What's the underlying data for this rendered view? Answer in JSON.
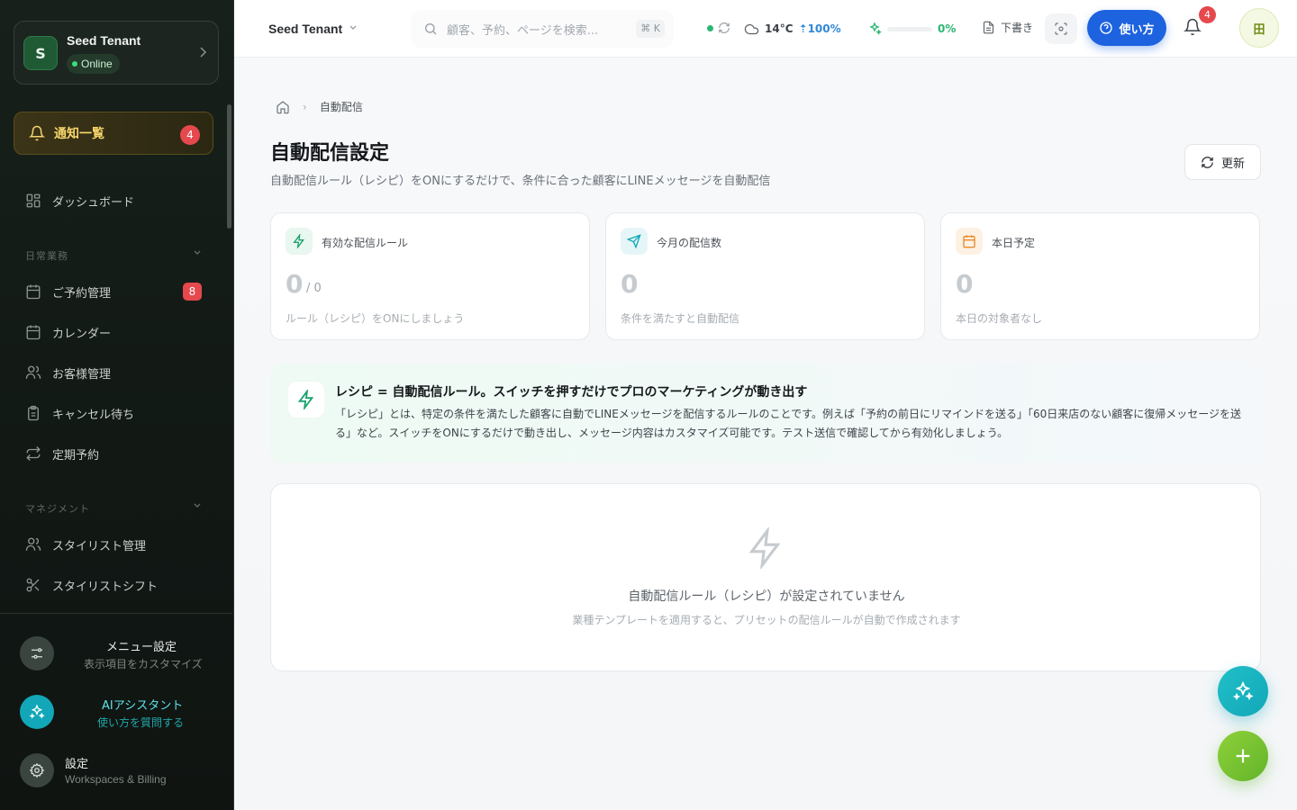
{
  "sidebar": {
    "tenant": {
      "initial": "S",
      "name": "Seed Tenant",
      "status": "Online"
    },
    "notifications": {
      "label": "通知一覧",
      "count": "4"
    },
    "dashboard": "ダッシュボード",
    "sections": [
      {
        "title": "日常業務",
        "items": [
          {
            "label": "ご予約管理",
            "badge": "8",
            "icon": "calendar-grid-icon"
          },
          {
            "label": "カレンダー",
            "icon": "calendar-icon"
          },
          {
            "label": "お客様管理",
            "icon": "users-icon"
          },
          {
            "label": "キャンセル待ち",
            "icon": "clipboard-icon"
          },
          {
            "label": "定期予約",
            "icon": "repeat-icon"
          }
        ]
      },
      {
        "title": "マネジメント",
        "items": [
          {
            "label": "スタイリスト管理",
            "icon": "users-icon"
          },
          {
            "label": "スタイリストシフト",
            "icon": "scissors-icon"
          }
        ]
      }
    ],
    "bottom": [
      {
        "title": "メニュー設定",
        "subtitle": "表示項目をカスタマイズ",
        "icon": "sliders-icon"
      },
      {
        "title": "AIアシスタント",
        "subtitle": "使い方を質問する",
        "icon": "sparkles-icon"
      },
      {
        "title": "設定",
        "subtitle": "Workspaces & Billing",
        "icon": "gear-icon"
      }
    ]
  },
  "topbar": {
    "workspace": "Seed Tenant",
    "search_placeholder": "顧客、予約、ページを検索...",
    "search_shortcut": "⌘ K",
    "weather": {
      "temp": "14°C",
      "humidity": "100%"
    },
    "progress": {
      "value": 0,
      "label": "0%"
    },
    "draft": "下書き",
    "howto": "使い方",
    "bell_count": "4",
    "user_initial": "田"
  },
  "main": {
    "breadcrumb": "自動配信",
    "title": "自動配信設定",
    "subtitle": "自動配信ルール（レシピ）をONにするだけで、条件に合った顧客にLINEメッセージを自動配信",
    "refresh": "更新",
    "stats": [
      {
        "label": "有効な配信ルール",
        "value": "0",
        "of": "/ 0",
        "hint": "ルール（レシピ）をONにしましょう",
        "color": "#1aa36b"
      },
      {
        "label": "今月の配信数",
        "value": "0",
        "hint": "条件を満たすと自動配信",
        "color": "#12a7b8"
      },
      {
        "label": "本日予定",
        "value": "0",
        "hint": "本日の対象者なし",
        "color": "#e8892b"
      }
    ],
    "info": {
      "title": "レシピ = 自動配信ルール。スイッチを押すだけでプロのマーケティングが動き出す",
      "body": "「レシピ」とは、特定の条件を満たした顧客に自動でLINEメッセージを配信するルールのことです。例えば「予約の前日にリマインドを送る」「60日来店のない顧客に復帰メッセージを送る」など。スイッチをONにするだけで動き出し、メッセージ内容はカスタマイズ可能です。テスト送信で確認してから有効化しましょう。"
    },
    "empty": {
      "title": "自動配信ルール（レシピ）が設定されていません",
      "subtitle": "業種テンプレートを適用すると、プリセットの配信ルールが自動で作成されます"
    }
  },
  "colors": {
    "accent_blue": "#1d63e0",
    "brand_green": "#1aa36b",
    "alert_red": "#e5484d"
  }
}
